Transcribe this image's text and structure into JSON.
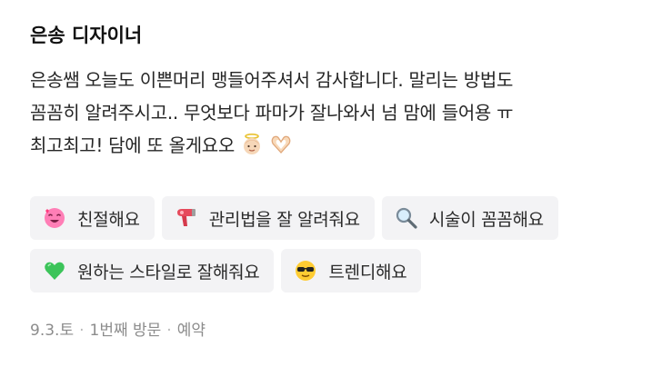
{
  "review": {
    "author": "은송 디자이너",
    "text_lines": [
      "은송쌤 오늘도 이쁜머리 맹들어주셔서 감사합니다. 말리는 방법도",
      "꼼꼼히 알려주시고.. 무엇보다 파마가 잘나와서 넘 맘에 들어용 ㅠ",
      "최고최고! 담에 또 올게요오"
    ],
    "trailing_emojis": [
      "angel-baby-icon",
      "heart-hands-icon"
    ]
  },
  "tags": [
    {
      "label": "친절해요",
      "icon": "heart-face-icon"
    },
    {
      "label": "관리법을 잘 알려줘요",
      "icon": "hair-dryer-icon"
    },
    {
      "label": "시술이 꼼꼼해요",
      "icon": "magnifier-icon"
    },
    {
      "label": "원하는 스타일로 잘해줘요",
      "icon": "green-heart-icon"
    },
    {
      "label": "트렌디해요",
      "icon": "sunglasses-face-icon"
    }
  ],
  "meta": {
    "date": "9.3.토",
    "visit": "1번째 방문",
    "type": "예약",
    "separator": "·"
  },
  "colors": {
    "tag_background": "#f3f3f5",
    "meta_text": "#8c8c8c",
    "author_text": "#111111"
  }
}
